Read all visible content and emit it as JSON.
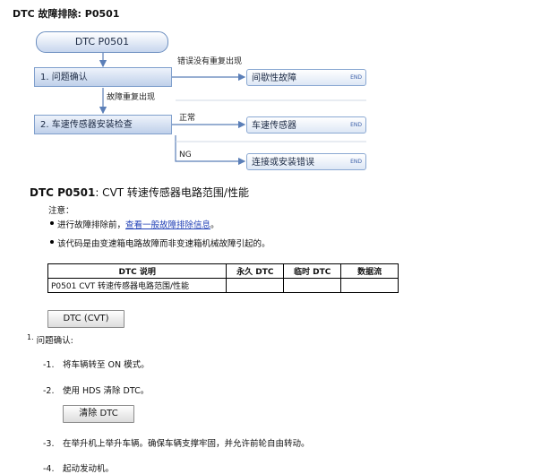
{
  "header": "DTC 故障排除: P0501",
  "flow": {
    "start": "DTC P0501",
    "step1": "1.  问题确认",
    "step2": "2.  车速传感器安装检查",
    "label_no_repeat": "错误没有重复出现",
    "label_repeat": "故障重复出现",
    "label_ok": "正常",
    "label_ng": "NG",
    "out1": "间歇性故障",
    "out2": "车速传感器",
    "out3": "连接或安装错误",
    "end": "END"
  },
  "title_code": "DTC P0501",
  "title_text": ": CVT 转速传感器电路范围/性能",
  "note_label": "注意：",
  "bullet1_prefix": "进行故障排除前，",
  "bullet1_link": "查看一般故障排除信息",
  "bullet1_suffix": "。",
  "bullet2": "该代码是由变速箱电路故障而非变速箱机械故障引起的。",
  "table": {
    "headers": [
      "DTC 说明",
      "永久 DTC",
      "临时 DTC",
      "数据流"
    ],
    "rows": [
      [
        "P0501 CVT 转速传感器电路范围/性能",
        "",
        "",
        ""
      ]
    ]
  },
  "btn_dtc": "DTC (CVT)",
  "section1": "问题确认:",
  "section1_num": "1.",
  "steps": [
    {
      "num": "-1.",
      "text": "将车辆转至 ON 模式。"
    },
    {
      "num": "-2.",
      "text": "使用 HDS 清除 DTC。"
    },
    {
      "num": "-3.",
      "text": "在举升机上举升车辆。确保车辆支撑牢固，并允许前轮自由转动。"
    },
    {
      "num": "-4.",
      "text": "起动发动机。"
    }
  ],
  "btn_clear": "清除  DTC",
  "colors": {
    "flow_border": "#7f9fcc",
    "link": "#1f3fb5",
    "arrow": "#5b7fb8"
  }
}
